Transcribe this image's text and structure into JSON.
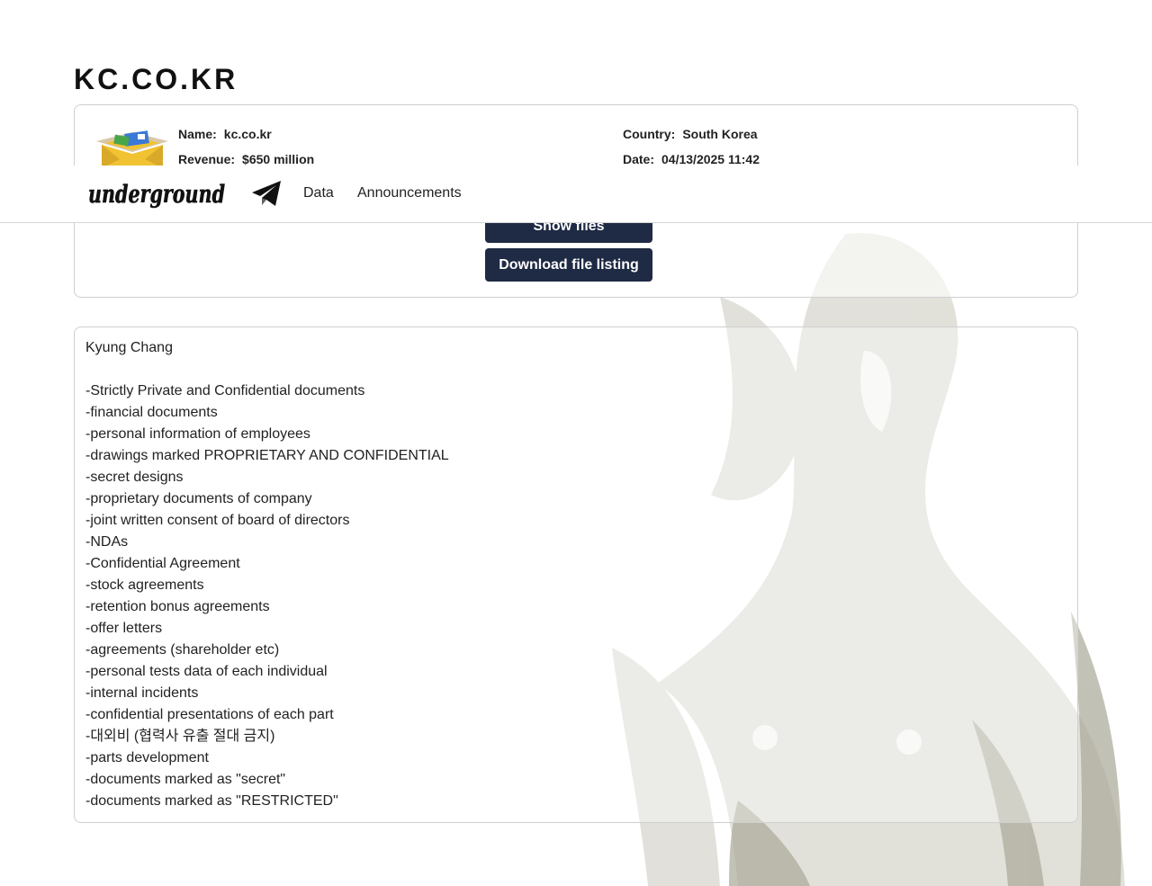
{
  "site": {
    "title": "KC.CO.KR"
  },
  "nav": {
    "brand": "underground",
    "links": [
      {
        "label": "Data"
      },
      {
        "label": "Announcements"
      }
    ]
  },
  "victim": {
    "name_label": "Name:",
    "name": "kc.co.kr",
    "revenue_label": "Revenue:",
    "revenue": "$650 million",
    "country_label": "Country:",
    "country": "South Korea",
    "date_label": "Date:",
    "date": "04/13/2025 11:42"
  },
  "actions": {
    "show_files": "Show files",
    "download_listing": "Download file listing"
  },
  "description": {
    "lines": [
      "Kyung Chang",
      "",
      "-Strictly Private and Confidential documents",
      "-financial documents",
      "-personal information of employees",
      "-drawings marked PROPRIETARY AND CONFIDENTIAL",
      "-secret designs",
      "-proprietary documents of company",
      "-joint written consent of board of directors",
      "-NDAs",
      "-Confidential Agreement",
      "-stock agreements",
      "-retention bonus agreements",
      "-offer letters",
      "-agreements (shareholder etc)",
      "-personal tests data of each individual",
      "-internal incidents",
      "-confidential presentations of each part",
      "-대외비 (협력사 유출 절대 금지)",
      "-parts development",
      "-documents marked as \"secret\"",
      "-documents marked as \"RESTRICTED\""
    ]
  },
  "icons": {
    "nav_channel": "telegram-icon",
    "company_logo": "open-box-icon"
  },
  "colors": {
    "button_bg": "#1f2a44",
    "button_text": "#ffffff",
    "background_figure": "#c9c8bc"
  }
}
